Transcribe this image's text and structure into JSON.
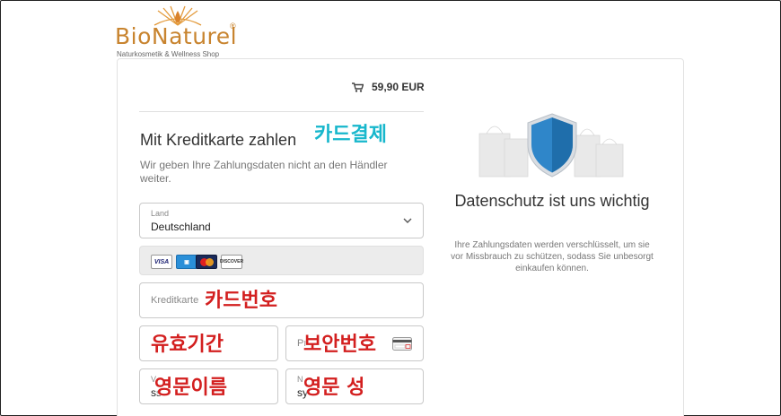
{
  "logo": {
    "wordmark": "BioNaturel",
    "registered": "®",
    "tagline": "Naturkosmetik & Wellness Shop",
    "brand_color": "#c8842f"
  },
  "cart": {
    "icon": "shopping-cart-icon",
    "total": "59,90 EUR"
  },
  "payment": {
    "title": "Mit Kreditkarte zahlen",
    "subtitle": "Wir geben Ihre Zahlungsdaten nicht an den Händler weiter.",
    "country": {
      "label": "Land",
      "value": "Deutschland"
    },
    "card_brands": [
      "VISA",
      "AMEX",
      "MasterCard",
      "DISCOVER"
    ],
    "card_number": {
      "placeholder": "Kreditkarte"
    },
    "expiry": {
      "placeholder": ""
    },
    "cvc": {
      "placeholder": "Pr"
    },
    "first_name": {
      "label": "V",
      "value": "ss"
    },
    "last_name": {
      "label": "N",
      "value": "sy"
    }
  },
  "annotations": {
    "card_payment": "카드결제",
    "card_number": "카드번호",
    "expiry": "유효기간",
    "security_code": "보안번호",
    "first_name": "영문이름",
    "last_name": "영문 성"
  },
  "privacy": {
    "title": "Datenschutz ist uns wichtig",
    "text": "Ihre Zahlungsdaten werden verschlüsselt, um sie vor Missbrauch zu schützen, sodass Sie unbesorgt einkaufen können.",
    "accent": "#2f86c9"
  }
}
